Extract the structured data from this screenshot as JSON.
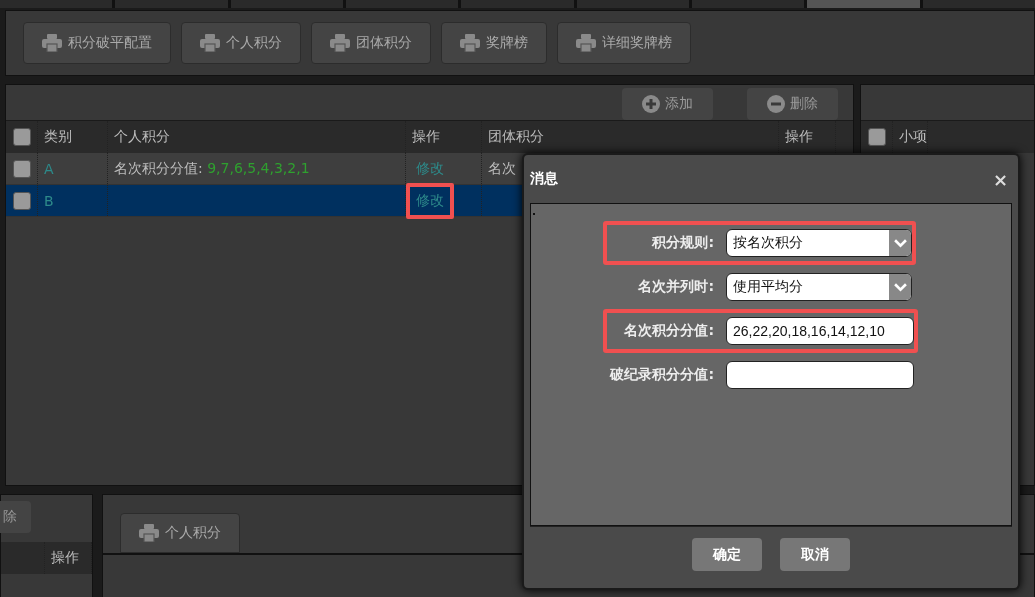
{
  "toolbar": {
    "buttons": [
      "积分破平配置",
      "个人积分",
      "团体积分",
      "奖牌榜",
      "详细奖牌榜"
    ]
  },
  "table_panel": {
    "buttons": [
      {
        "label": "添加",
        "kind": "add"
      },
      {
        "label": "删除",
        "kind": "remove"
      }
    ],
    "header_checked": false,
    "columns": [
      "类别",
      "个人积分",
      "操作",
      "团体积分",
      "操作"
    ],
    "rows": [
      {
        "checked": false,
        "selected": false,
        "category": "A",
        "personal_label": "名次积分分值: ",
        "personal_value": "9,7,6,5,4,3,2,1",
        "action": "修改",
        "action_highlighted": false,
        "team": "名次"
      },
      {
        "checked": false,
        "selected": true,
        "category": "B",
        "action": "修改",
        "action_highlighted": true
      }
    ]
  },
  "side_panel": {
    "header_checked": false,
    "columns": [
      "小项"
    ]
  },
  "bottom_left": {
    "button": "除",
    "columns": [
      "操作"
    ]
  },
  "bottom_right": {
    "tabs": [
      "个人积分"
    ]
  },
  "dialog": {
    "title": "消息",
    "close": "×",
    "fields": [
      {
        "label": "积分规则:",
        "kind": "select",
        "value": "按名次积分",
        "highlighted": true
      },
      {
        "label": "名次并列时:",
        "kind": "select",
        "value": "使用平均分",
        "highlighted": false
      },
      {
        "label": "名次积分分值:",
        "kind": "text",
        "value": "26,22,20,18,16,14,12,10",
        "highlighted": true
      },
      {
        "label": "破纪录积分分值:",
        "kind": "text",
        "highlighted": false
      }
    ],
    "buttons": [
      "确定",
      "取消"
    ]
  }
}
